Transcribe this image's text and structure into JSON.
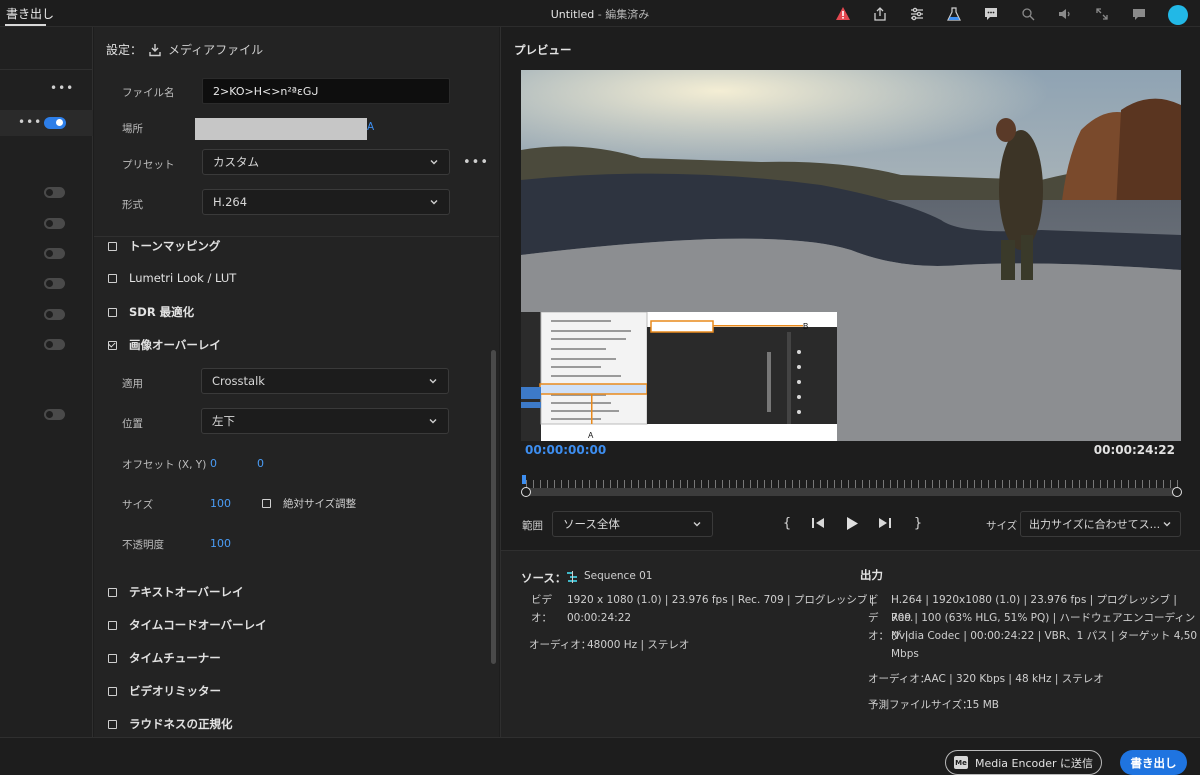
{
  "topbar": {
    "tab_export": "書き出し",
    "title": "Untitled",
    "title_suffix": " - 編集済み",
    "icons": [
      "warning-icon",
      "share-icon",
      "settings-sliders-icon",
      "lab-flask-icon",
      "comments-icon",
      "search-sparkle-icon",
      "volume-icon",
      "fullscreen-icon",
      "feedback-icon",
      "profile-avatar"
    ],
    "warning_color": "#e34850"
  },
  "settings": {
    "header_label": "設定：",
    "header_target": "メディアファイル",
    "filename_label": "ファイル名",
    "filename_value": "2>KO>H<>n²ªεGᒍ",
    "location_label": "場所",
    "location_tail": "A",
    "preset_label": "プリセット",
    "preset_value": "カスタム",
    "format_label": "形式",
    "format_value": "H.264"
  },
  "sections": {
    "tone_mapping": "トーンマッピング",
    "lumetri": "Lumetri Look / LUT",
    "sdr": "SDR 最適化",
    "image_overlay": "画像オーバーレイ",
    "text_overlay": "テキストオーバーレイ",
    "timecode_overlay": "タイムコードオーバーレイ",
    "time_tuner": "タイムチューナー",
    "video_limiter": "ビデオリミッター",
    "loudness": "ラウドネスの正規化"
  },
  "overlay": {
    "apply_label": "適用",
    "apply_value": "Crosstalk",
    "position_label": "位置",
    "position_value": "左下",
    "offset_label": "オフセット (X, Y)",
    "offset_x": "0",
    "offset_y": "0",
    "size_label": "サイズ",
    "size_value": "100",
    "absolute_size_label": "絶対サイズ調整",
    "opacity_label": "不透明度",
    "opacity_value": "100"
  },
  "preview": {
    "title": "プレビュー",
    "timecode_in": "00:00:00:00",
    "timecode_out": "00:00:24:22",
    "callout_a": "A",
    "callout_b": "B",
    "range_label": "範囲",
    "range_value": "ソース全体",
    "size_label": "サイズ",
    "size_value": "出力サイズに合わせてス..."
  },
  "source": {
    "heading": "ソース：",
    "sequence_name": "Sequence 01",
    "video_label_1": "ビデ",
    "video_label_2": "オ：",
    "video_line1": "1920 x 1080 (1.0) | 23.976 fps | Rec. 709 | プログレッシブ |",
    "video_line2": "00:00:24:22",
    "audio_label": "オーディオ：",
    "audio_value": "48000 Hz | ステレオ"
  },
  "output": {
    "heading": "出力",
    "video_label_1": "ビ",
    "video_label_2": "デ",
    "video_label_3": "オ：",
    "video_line1": "H.264 | 1920x1080 (1.0) | 23.976 fps | プログレッシブ | Rec.",
    "video_line2": "709 | 100 (63% HLG, 51% PQ) | ハードウェアエンコーディング |",
    "video_line3": "Nvidia Codec | 00:00:24:22 | VBR、1 パス | ターゲット 4,50",
    "video_line4": "Mbps",
    "audio_label": "オーディオ：",
    "audio_value": "AAC | 320 Kbps | 48 kHz | ステレオ",
    "filesize_label": "予測ファイルサイズ：",
    "filesize_value": "15 MB"
  },
  "footer": {
    "media_encoder_button": "Media Encoder に送信",
    "media_encoder_logo": "Me",
    "export_button": "書き出し",
    "accent": "#1f74e0"
  }
}
